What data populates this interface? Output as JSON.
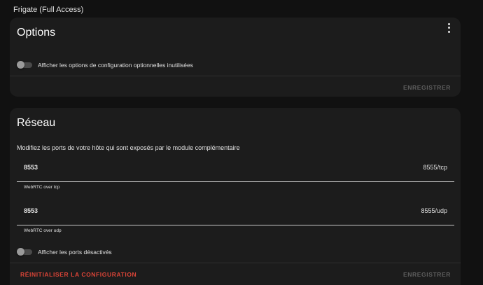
{
  "page": {
    "title": "Frigate (Full Access)"
  },
  "options": {
    "title": "Options",
    "toggle_label": "Afficher les options de configuration optionnelles inutilisées",
    "toggle_on": false,
    "save_label": "ENREGISTRER"
  },
  "network": {
    "title": "Réseau",
    "description": "Modifiez les ports de votre hôte qui sont exposés par le module complémentaire",
    "ports": [
      {
        "value": "8553",
        "suffix": "8555/tcp",
        "helper": "WebRTC over tcp"
      },
      {
        "value": "8553",
        "suffix": "8555/udp",
        "helper": "WebRTC over udp"
      }
    ],
    "toggle_label": "Afficher les ports désactivés",
    "toggle_on": false,
    "reset_label": "RÉINITIALISER LA CONFIGURATION",
    "save_label": "ENREGISTRER"
  },
  "colors": {
    "background": "#111111",
    "card": "#1c1c1c",
    "danger": "#db4437",
    "disabled": "#5e5e5e"
  },
  "icons": {
    "menu": "dots-vertical-icon"
  }
}
